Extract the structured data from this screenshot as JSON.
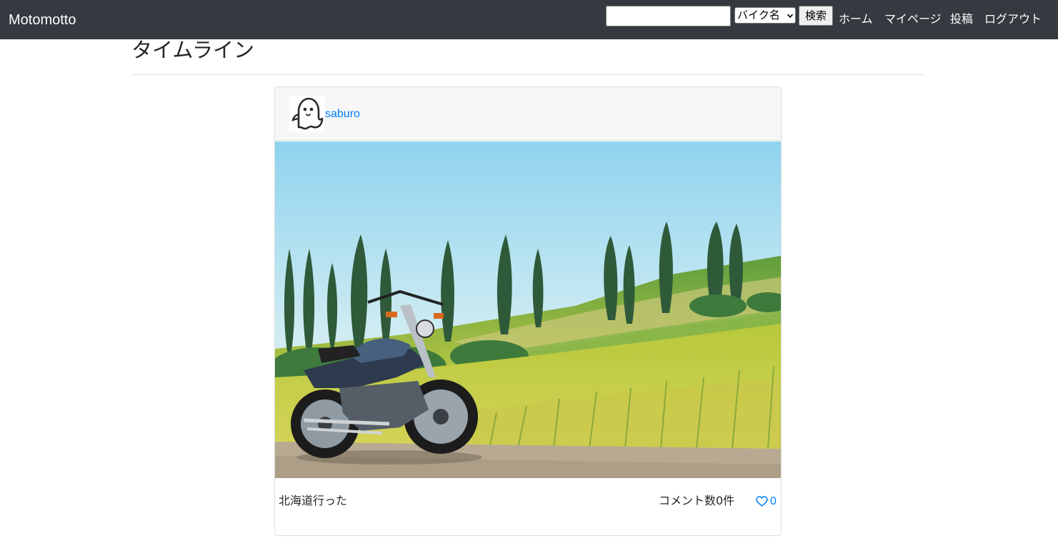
{
  "navbar": {
    "brand": "Motomotto",
    "search": {
      "value": "",
      "placeholder": "",
      "select_value": "バイク名",
      "button_label": "検索"
    },
    "links": [
      "ホーム",
      "マイページ",
      "投稿",
      "ログアウト"
    ]
  },
  "page": {
    "title": "タイムライン"
  },
  "posts": [
    {
      "username": "saburo",
      "avatar_icon": "ghost-icon",
      "image": "motorcycle-photo",
      "caption": "北海道行った",
      "comments_label": "コメント数0件",
      "like_icon": "heart-outline-icon",
      "likes": "0"
    }
  ],
  "colors": {
    "navbar_bg": "#343a40",
    "link": "#007bff",
    "card_header_bg": "#f7f7f7"
  }
}
